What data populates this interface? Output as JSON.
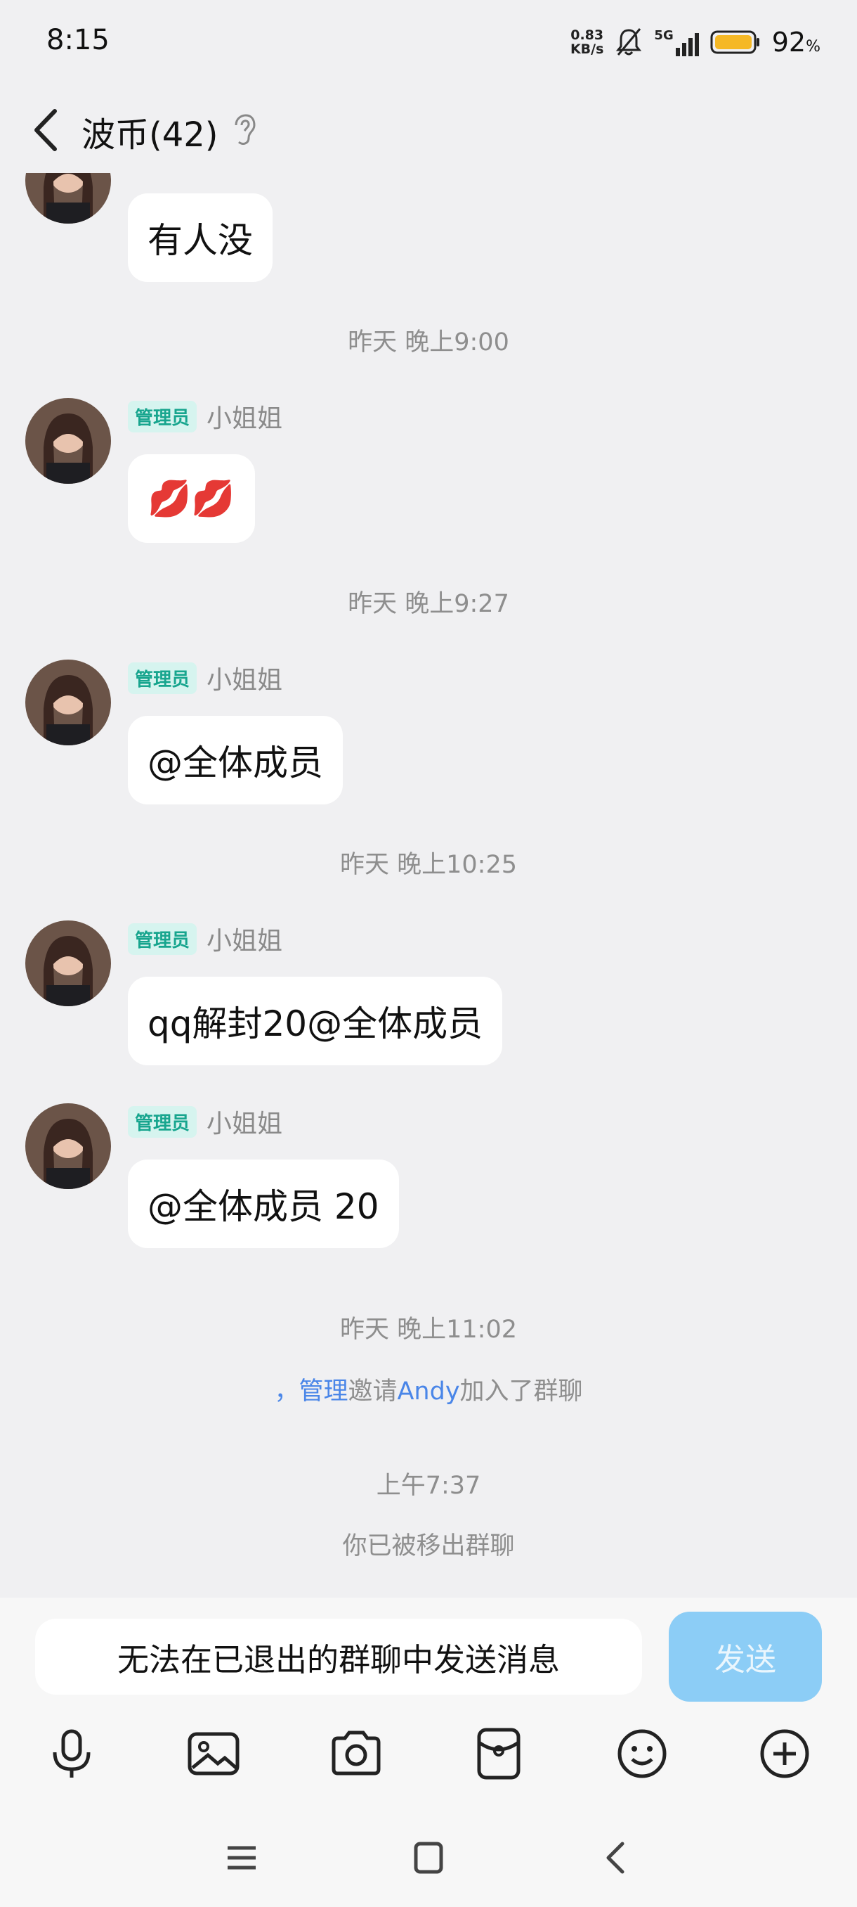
{
  "status": {
    "time": "8:15",
    "net_speed_value": "0.83",
    "net_speed_unit": "KB/s",
    "signal": "5G",
    "battery": "92",
    "battery_unit": "%"
  },
  "header": {
    "title": "波币(42)"
  },
  "messages": [
    {
      "sender": "",
      "text": "有人没"
    },
    {
      "time": "昨天 晚上9:00",
      "badge": "管理员",
      "sender": "小姐姐",
      "text": "💋💋"
    },
    {
      "time": "昨天 晚上9:27",
      "badge": "管理员",
      "sender": "小姐姐",
      "text": "@全体成员"
    },
    {
      "time": "昨天 晚上10:25",
      "badge": "管理员",
      "sender": "小姐姐",
      "text": "qq解封20@全体成员"
    },
    {
      "badge": "管理员",
      "sender": "小姐姐",
      "text": "@全体成员 20"
    }
  ],
  "system": {
    "time1": "昨天 晚上11:02",
    "invite_comma": "，",
    "invite_admin": "管理",
    "invite_mid": "邀请",
    "invite_user": "Andy",
    "invite_end": "加入了群聊",
    "time2": "上午7:37",
    "removed": "你已被移出群聊"
  },
  "input": {
    "placeholder": "无法在已退出的群聊中发送消息",
    "send_label": "发送"
  },
  "colors": {
    "accent": "#17a58e",
    "link": "#4a86e8",
    "send_bg": "#8ccdf6"
  }
}
